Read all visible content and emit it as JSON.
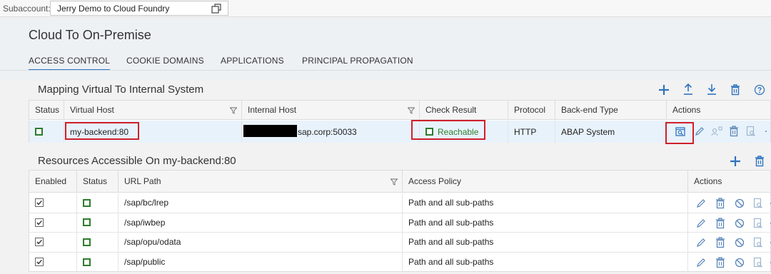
{
  "subaccount": {
    "label": "Subaccount:",
    "value": "Jerry Demo to Cloud Foundry"
  },
  "page": {
    "title": "Cloud To On-Premise"
  },
  "tabs": [
    {
      "label": "ACCESS CONTROL",
      "active": true
    },
    {
      "label": "COOKIE DOMAINS"
    },
    {
      "label": "APPLICATIONS"
    },
    {
      "label": "PRINCIPAL PROPAGATION"
    }
  ],
  "mapping": {
    "title": "Mapping Virtual To Internal System",
    "columns": [
      "Status",
      "Virtual Host",
      "Internal Host",
      "Check Result",
      "Protocol",
      "Back-end Type",
      "Actions"
    ],
    "rows": [
      {
        "status": "ok",
        "virtual_host": "my-backend:80",
        "internal_host": "sap.corp:50033",
        "check_result": "Reachable",
        "protocol": "HTTP",
        "backend_type": "ABAP System"
      }
    ],
    "toolbar_icons": [
      "plus-icon",
      "upload-icon",
      "download-icon",
      "trash-icon",
      "help-icon"
    ]
  },
  "resources": {
    "title": "Resources Accessible On my-backend:80",
    "columns": [
      "Enabled",
      "Status",
      "URL Path",
      "Access Policy",
      "Actions"
    ],
    "rows": [
      {
        "enabled": true,
        "url_path": "/sap/bc/lrep",
        "policy": "Path and all sub-paths"
      },
      {
        "enabled": true,
        "url_path": "/sap/iwbep",
        "policy": "Path and all sub-paths"
      },
      {
        "enabled": true,
        "url_path": "/sap/opu/odata",
        "policy": "Path and all sub-paths"
      },
      {
        "enabled": true,
        "url_path": "/sap/public",
        "policy": "Path and all sub-paths"
      }
    ]
  },
  "colors": {
    "accent": "#2f74c0",
    "status_green": "#2b7d2b",
    "highlight_red": "#d0202a"
  }
}
